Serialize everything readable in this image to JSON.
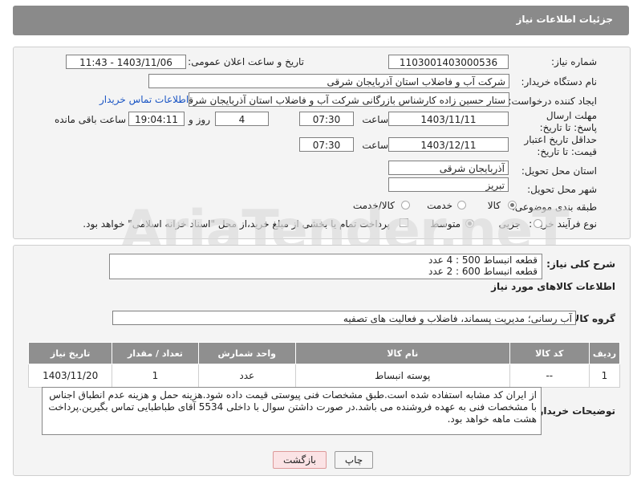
{
  "header": {
    "title": "جزئیات اطلاعات نیاز"
  },
  "form": {
    "need_number_label": "شماره نیاز:",
    "need_number": "1103001403000536",
    "announce_label": "تاریخ و ساعت اعلان عمومی:",
    "announce_value": "1403/11/06 - 11:43",
    "buyer_org_label": "نام دستگاه خریدار:",
    "buyer_org": "شرکت آب و فاضلاب استان آذربایجان شرقی",
    "creator_label": "ایجاد کننده درخواست:",
    "creator": "ستار حسین زاده کارشناس بازرگانی شرکت آب و فاضلاب استان آذربایجان شرقی",
    "contact_link": "اطلاعات تماس خریدار",
    "deadline_label": "مهلت ارسال پاسخ: تا تاریخ:",
    "deadline_date": "1403/11/11",
    "time_label": "ساعت",
    "deadline_time": "07:30",
    "days_value": "4",
    "days_label": "روز و",
    "remaining_time": "19:04:11",
    "remaining_label": "ساعت باقی مانده",
    "validity_label": "حداقل تاریخ اعتبار قیمت: تا تاریخ:",
    "validity_date": "1403/12/11",
    "validity_time": "07:30",
    "province_label": "استان محل تحویل:",
    "province": "آذربایجان شرقی",
    "city_label": "شهر محل تحویل:",
    "city": "تبریز",
    "category_label": "طبقه بندی موضوعی:",
    "category_options": [
      "کالا",
      "خدمت",
      "کالا/خدمت"
    ],
    "process_label": "نوع فرآیند خرید :",
    "process_options": [
      "جزیی",
      "متوسط"
    ],
    "payment_text": "پرداخت تمام یا بخشی از مبلغ خرید،از محل \"اسناد خزانه اسلامی\" خواهد بود."
  },
  "general_desc": {
    "label": "شرح کلی نیاز:",
    "line1": "قطعه انبساط 500 : 4 عدد",
    "line2": "قطعه انبساط 600 : 2 عدد"
  },
  "goods_section": {
    "title": "اطلاعات کالاهای مورد نیاز",
    "group_label": "گروه کالا:",
    "group_value": "آب رسانی؛ مدیریت پسماند، فاضلاب و فعالیت های تصفیه"
  },
  "table": {
    "headers": [
      "ردیف",
      "کد کالا",
      "نام کالا",
      "واحد شمارش",
      "تعداد / مقدار",
      "تاریخ نیاز"
    ],
    "rows": [
      [
        "1",
        "--",
        "پوسته انبساط",
        "عدد",
        "1",
        "1403/11/20"
      ]
    ]
  },
  "buyer_notes": {
    "label": "توضیحات خریدار:",
    "text": "از ایران کد مشابه استفاده شده است.طبق مشخصات فنی پیوستی قیمت داده شود.هزینه حمل و هزینه عدم انطباق اجناس با مشخصات فنی به عهده فروشنده می باشد.در صورت داشتن سوال با داخلی 5534 آقای طباطبایی تماس بگیرین.پرداخت هشت ماهه خواهد بود."
  },
  "buttons": {
    "print": "چاپ",
    "back": "بازگشت"
  },
  "watermark": "AriaTender.neT",
  "colors": {
    "header": "#8a8a8a",
    "link": "#1a55c4",
    "back_button": "#fbe3e5"
  }
}
